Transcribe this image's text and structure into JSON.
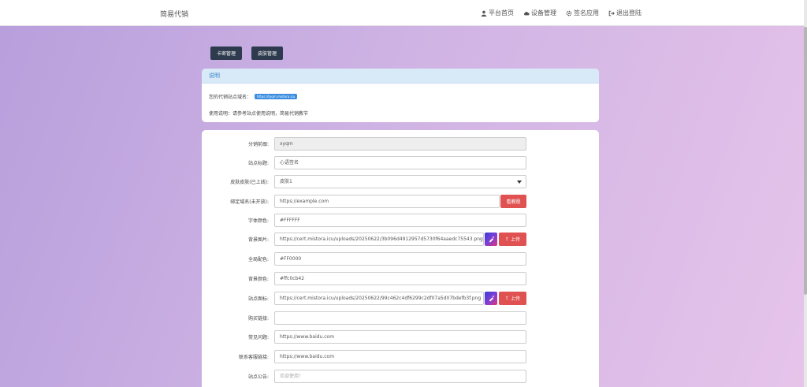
{
  "header": {
    "brand": "简易代销",
    "nav": [
      {
        "icon": "user-icon",
        "label": "平台首页"
      },
      {
        "icon": "cloud-icon",
        "label": "设备管理"
      },
      {
        "icon": "gear-icon",
        "label": "签名应用"
      },
      {
        "icon": "logout-icon",
        "label": "退出登陆"
      }
    ]
  },
  "actions": {
    "card_manage": "卡密管理",
    "skin_manage": "皮肤管理"
  },
  "info": {
    "title": "说明",
    "domain_label": "您的代销站点域名：",
    "domain_badge": "https://tyqm.mistora.icu",
    "usage": "使用说明：请参考站点使用说明，简易代销教节"
  },
  "form": {
    "prefix": {
      "label": "分销前缀:",
      "value": "xyqm"
    },
    "site_title": {
      "label": "站点标题:",
      "value": "心语签名"
    },
    "skin": {
      "label": "皮肤皮肤(已上线):",
      "value": "皮肤1"
    },
    "domain": {
      "label": "绑定域名(未开放):",
      "value": "https://example.com",
      "button": "看教程"
    },
    "font_color": {
      "label": "字体颜色:",
      "value": "#FFFFFF"
    },
    "bg_image": {
      "label": "背景图片:",
      "value": "https://cert.mistora.icu/uploads/20250622/3b096d4912957d5730f64aaedc75543.png",
      "button": "上传"
    },
    "theme_color": {
      "label": "全局配色:",
      "value": "#FF0000"
    },
    "bg_color": {
      "label": "背景颜色:",
      "value": "#ffc0cb42"
    },
    "site_icon": {
      "label": "站点图标:",
      "value": "https://cert.mistora.icu/uploads/20250622/99c462c4df6299c2df07a5d07bdefb3f.png",
      "button": "上传"
    },
    "buy_link": {
      "label": "购买链接:",
      "value": ""
    },
    "faq": {
      "label": "常见问题:",
      "value": "https://www.baidu.com"
    },
    "support_link": {
      "label": "联系客服链接:",
      "value": "https://www.baidu.com"
    },
    "notice": {
      "label": "站点公告:",
      "placeholder": "欢迎使用！"
    }
  }
}
